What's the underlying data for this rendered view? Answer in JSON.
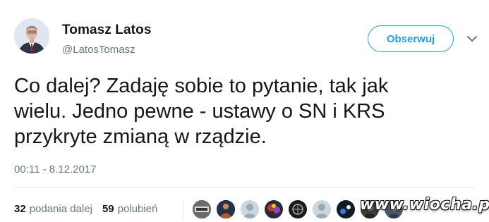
{
  "tweet": {
    "author_name": "Tomasz Latos",
    "author_handle": "@LatosTomasz",
    "follow_label": "Obserwuj",
    "text": "Co dalej? Zadaję sobie to pytanie, tak jak\nwielu. Jedno pewne - ustawy o SN i KRS\nprzykryte zmianą w rządzie.",
    "timestamp": "00:11 - 8.12.2017",
    "retweets": {
      "count": "32",
      "label": "podania dalej"
    },
    "likes": {
      "count": "59",
      "label": "polubień"
    },
    "liker_avatars": [
      "avatar-1",
      "avatar-2",
      "avatar-3",
      "avatar-4",
      "avatar-5",
      "avatar-6",
      "avatar-7",
      "avatar-8",
      "avatar-9"
    ]
  },
  "watermark": "www.wiocha.pl",
  "icons": {
    "menu": "chevron-down-icon"
  },
  "colors": {
    "accent": "#1da1f2",
    "secondary_text": "#657786",
    "primary_text": "#14171a",
    "divider": "#e6ecf0"
  }
}
